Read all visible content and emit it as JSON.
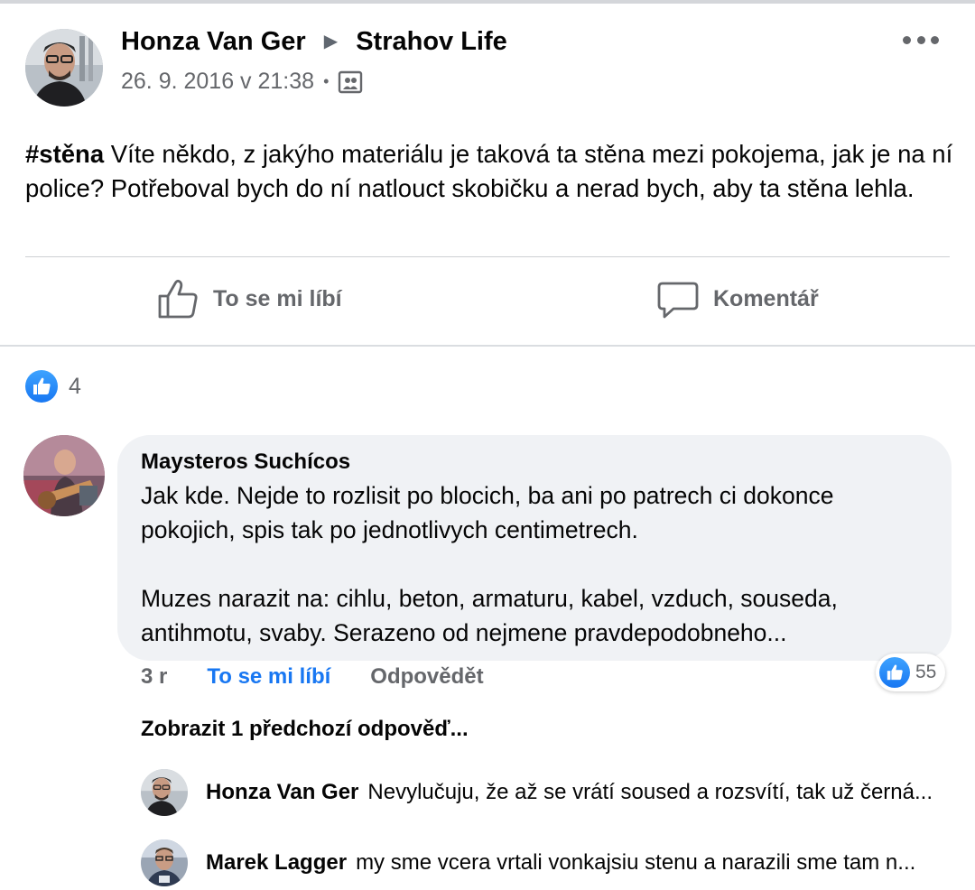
{
  "post": {
    "author": "Honza Van Ger",
    "arrow": "▶",
    "group": "Strahov Life",
    "timestamp": "26. 9. 2016 v 21:38",
    "separator": "•",
    "hashtag": "#stěna",
    "text": " Víte někdo, z jakýho materiálu je taková ta stěna mezi pokojema, jak je na ní police? Potřeboval bych do ní natlouct skobičku a nerad bych, aby ta stěna lehla.",
    "like_label": "To se mi líbí",
    "comment_label": "Komentář",
    "reaction_count": "4",
    "icons": {
      "more": "more-options-icon",
      "group": "group-icon",
      "like": "thumbs-up-icon",
      "comment": "comment-icon"
    }
  },
  "comment": {
    "author": "Maysteros Suchícos",
    "paragraph1": "Jak kde. Nejde to rozlisit po blocich, ba ani po patrech ci dokonce pokojich, spis tak po jednotlivych centimetrech.",
    "paragraph2": "Muzes narazit na: cihlu, beton, armaturu, kabel, vzduch, souseda, antihmotu, svaby. Serazeno od nejmene pravdepodobneho...",
    "age": "3 r",
    "like_label": "To se mi líbí",
    "reply_label": "Odpovědět",
    "reaction_count": "55",
    "show_previous": "Zobrazit 1 předchozí odpověď..."
  },
  "replies": [
    {
      "author": "Honza Van Ger",
      "text": "Nevylučuju, že až se vrátí soused a rozsvítí, tak už černá..."
    },
    {
      "author": "Marek Lagger",
      "text": "my sme vcera vrtali vonkajsiu stenu a narazili sme tam n..."
    }
  ],
  "colors": {
    "accent": "#1877f2",
    "secondary_text": "#65676b",
    "bubble_bg": "#f0f2f5"
  }
}
